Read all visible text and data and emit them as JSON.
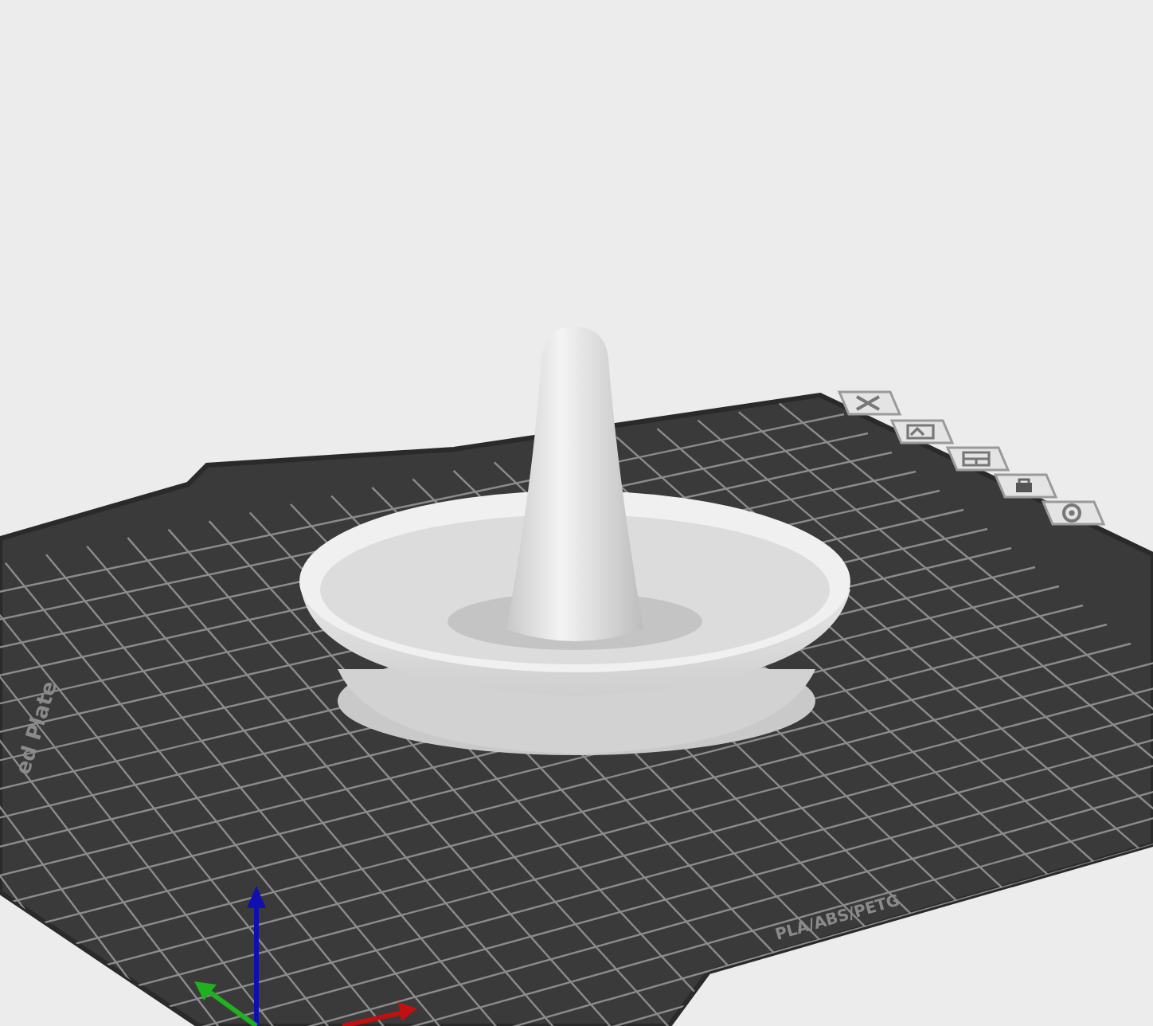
{
  "plate": {
    "name_label": "ed Plate",
    "filament_label": "PLA/ABS/PETG"
  },
  "plate_toolbar": [
    {
      "kind": "close"
    },
    {
      "kind": "picture"
    },
    {
      "kind": "layout"
    },
    {
      "kind": "lock"
    },
    {
      "kind": "settings"
    }
  ]
}
